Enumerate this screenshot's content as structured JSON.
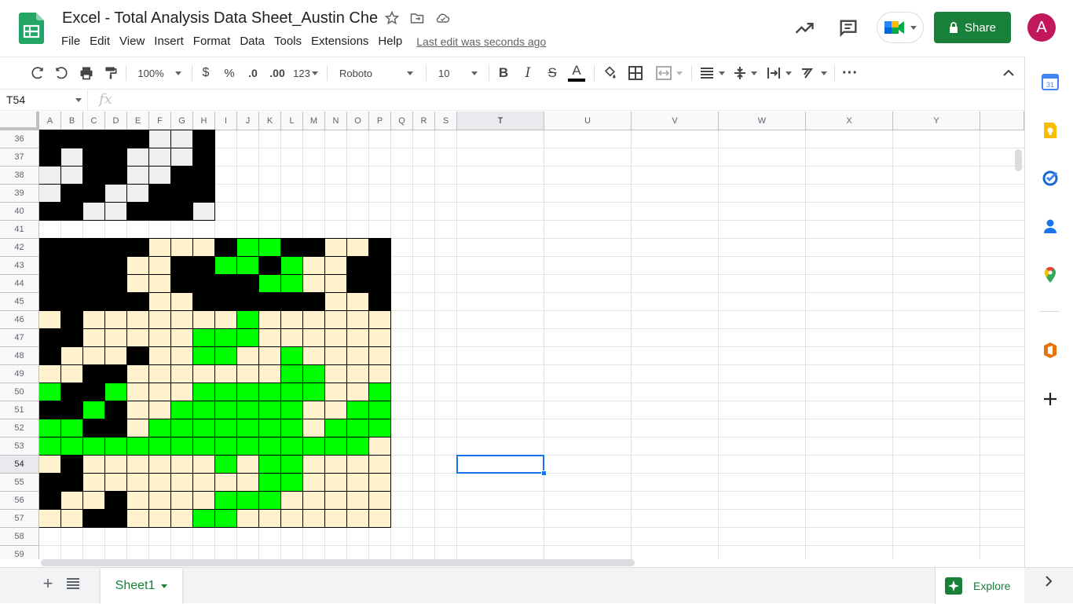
{
  "header": {
    "title": "Excel - Total Analysis Data Sheet_Austin Che",
    "menus": [
      "File",
      "Edit",
      "View",
      "Insert",
      "Format",
      "Data",
      "Tools",
      "Extensions",
      "Help"
    ],
    "last_edit": "Last edit was seconds ago",
    "share_label": "Share",
    "avatar_letter": "A"
  },
  "toolbar": {
    "zoom": "100%",
    "currency": "$",
    "percent": "%",
    "dec_less": ".0",
    "dec_more": ".00",
    "more_formats": "123",
    "font": "Roboto",
    "font_size": "10"
  },
  "formula_bar": {
    "name_box": "T54",
    "fx": "fx",
    "content": ""
  },
  "grid": {
    "columns": [
      "A",
      "B",
      "C",
      "D",
      "E",
      "F",
      "G",
      "H",
      "I",
      "J",
      "K",
      "L",
      "M",
      "N",
      "O",
      "P",
      "Q",
      "R",
      "S",
      "T",
      "U",
      "V",
      "W",
      "X",
      "Y"
    ],
    "rows": [
      "36",
      "37",
      "38",
      "39",
      "40",
      "41",
      "42",
      "43",
      "44",
      "45",
      "46",
      "47",
      "48",
      "49",
      "50",
      "51",
      "52",
      "53",
      "54",
      "55",
      "56",
      "57",
      "58",
      "59"
    ],
    "selected_cell": "T54",
    "selected_column": "T",
    "selected_row": "54",
    "palette": {
      "k": "#000000",
      "w": "#efefef",
      "c": "#fff2cc",
      "g": "#00ff00"
    },
    "fills": [
      "kkkkkwwk",
      "kwkkwwwk",
      "wwkkwwkk",
      "wkkwwkkk",
      "kkwwkkkw",
      "",
      "kkkkkccckggkkcck",
      "kkkkcckkgg kgcckk",
      "kkkkcckkkkggcckk",
      "kkkkkcckkkkkkcck",
      "ckcccccccgcccccc",
      "kkcccccgggcccccc",
      "kccckccggccgcccc",
      "cckkcccccccggccc",
      "gkkgcccggggggccg",
      "kkgkccggggggccgg",
      "ggkkcgggggggcggg",
      "gggggggggggggggc",
      "ckccccccgcggcccc",
      "kkccccccccggcccc",
      "kcckccccgggccccc",
      "cckkcccggccccccc"
    ]
  },
  "sheet_tab": "Sheet1",
  "explore_label": "Explore",
  "side_panel": [
    "calendar-icon",
    "keep-icon",
    "tasks-icon",
    "contacts-icon",
    "maps-icon",
    "office-addon-icon",
    "add-ons-plus-icon"
  ]
}
